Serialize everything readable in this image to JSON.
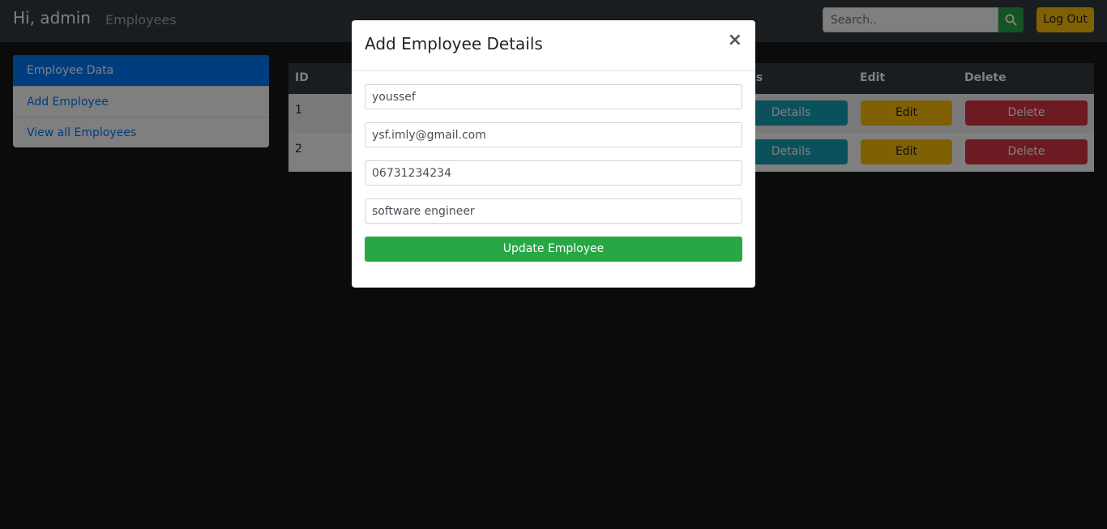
{
  "navbar": {
    "brand": "Hi, admin",
    "link": "Employees",
    "search_placeholder": "Search..",
    "logout_label": "Log Out"
  },
  "sidebar": {
    "items": [
      {
        "label": "Employee Data",
        "active": true
      },
      {
        "label": "Add Employee",
        "active": false
      },
      {
        "label": "View all Employees",
        "active": false
      }
    ]
  },
  "table": {
    "headers": {
      "id": "ID",
      "details": "Details",
      "edit": "Edit",
      "delete": "Delete"
    },
    "rows": [
      {
        "id": "1",
        "details_label": "Details",
        "edit_label": "Edit",
        "delete_label": "Delete"
      },
      {
        "id": "2",
        "details_label": "Details",
        "edit_label": "Edit",
        "delete_label": "Delete"
      }
    ]
  },
  "modal": {
    "title": "Add Employee Details",
    "close_symbol": "×",
    "fields": {
      "name": "youssef",
      "email": "ysf.imly@gmail.com",
      "phone": "06731234234",
      "job": "software engineer"
    },
    "submit_label": "Update Employee"
  },
  "colors": {
    "primary": "#007bff",
    "success": "#28a745",
    "warning": "#ffc107",
    "danger": "#dc3545",
    "info": "#17a2b8",
    "navbar": "#343a40"
  }
}
